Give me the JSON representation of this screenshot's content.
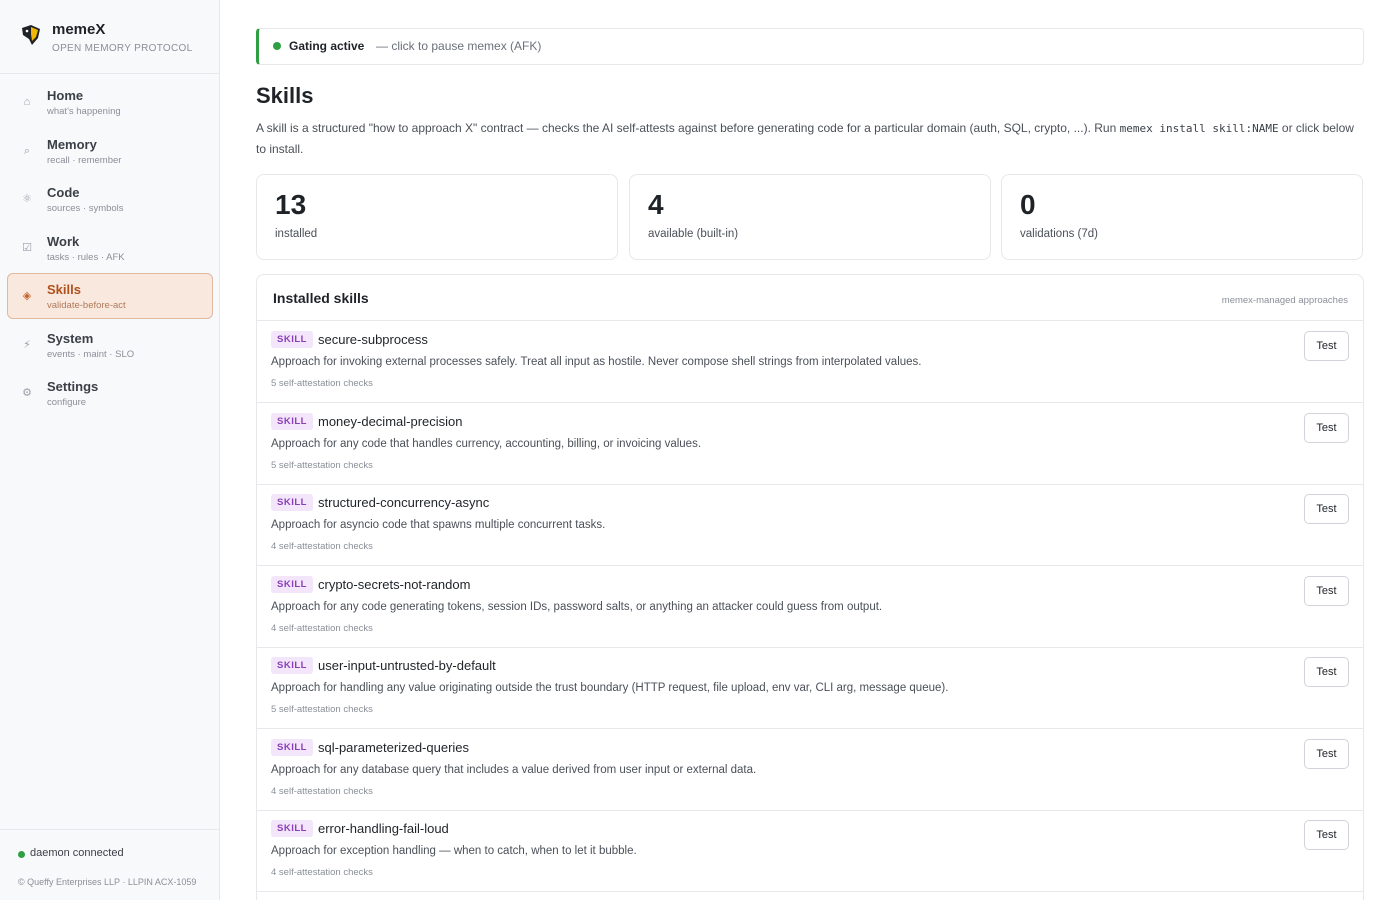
{
  "brand": {
    "name": "memeX",
    "subtitle": "OPEN MEMORY PROTOCOL"
  },
  "nav": {
    "items": [
      {
        "label": "Home",
        "sub": "what's happening",
        "icon": "home-icon",
        "glyph": "⌂",
        "active": false
      },
      {
        "label": "Memory",
        "sub": "recall · remember",
        "icon": "search-icon",
        "glyph": "⌕",
        "active": false
      },
      {
        "label": "Code",
        "sub": "sources · symbols",
        "icon": "atom-icon",
        "glyph": "⚛",
        "active": false
      },
      {
        "label": "Work",
        "sub": "tasks · rules · AFK",
        "icon": "checkbox-icon",
        "glyph": "☑",
        "active": false
      },
      {
        "label": "Skills",
        "sub": "validate-before-act",
        "icon": "diamond-icon",
        "glyph": "◈",
        "active": true
      },
      {
        "label": "System",
        "sub": "events · maint · SLO",
        "icon": "bolt-icon",
        "glyph": "⚡",
        "active": false
      },
      {
        "label": "Settings",
        "sub": "configure",
        "icon": "gear-icon",
        "glyph": "⚙",
        "active": false
      }
    ]
  },
  "footer": {
    "status": "daemon connected",
    "copyright": "© Queffy Enterprises LLP · LLPIN ACX-1059"
  },
  "gating": {
    "title": "Gating active",
    "hint": "— click to pause memex (AFK)"
  },
  "page": {
    "title": "Skills",
    "desc_before": "A skill is a structured \"how to approach X\" contract — checks the AI self-attests against before generating code for a particular domain (auth, SQL, crypto, ...). Run ",
    "desc_code": "memex install skill:NAME",
    "desc_after": " or click below to install."
  },
  "stats": [
    {
      "value": "13",
      "label": "installed"
    },
    {
      "value": "4",
      "label": "available (built-in)"
    },
    {
      "value": "0",
      "label": "validations (7d)"
    }
  ],
  "panel": {
    "title": "Installed skills",
    "note": "memex-managed approaches",
    "badge": "SKILL",
    "test_label": "Test",
    "skills": [
      {
        "name": "secure-subprocess",
        "desc": "Approach for invoking external processes safely. Treat all input as hostile. Never compose shell strings from interpolated values.",
        "checks": "5 self-attestation checks"
      },
      {
        "name": "money-decimal-precision",
        "desc": "Approach for any code that handles currency, accounting, billing, or invoicing values.",
        "checks": "5 self-attestation checks"
      },
      {
        "name": "structured-concurrency-async",
        "desc": "Approach for asyncio code that spawns multiple concurrent tasks.",
        "checks": "4 self-attestation checks"
      },
      {
        "name": "crypto-secrets-not-random",
        "desc": "Approach for any code generating tokens, session IDs, password salts, or anything an attacker could guess from output.",
        "checks": "4 self-attestation checks"
      },
      {
        "name": "user-input-untrusted-by-default",
        "desc": "Approach for handling any value originating outside the trust boundary (HTTP request, file upload, env var, CLI arg, message queue).",
        "checks": "5 self-attestation checks"
      },
      {
        "name": "sql-parameterized-queries",
        "desc": "Approach for any database query that includes a value derived from user input or external data.",
        "checks": "4 self-attestation checks"
      },
      {
        "name": "error-handling-fail-loud",
        "desc": "Approach for exception handling — when to catch, when to let it bubble.",
        "checks": "4 self-attestation checks"
      }
    ]
  }
}
